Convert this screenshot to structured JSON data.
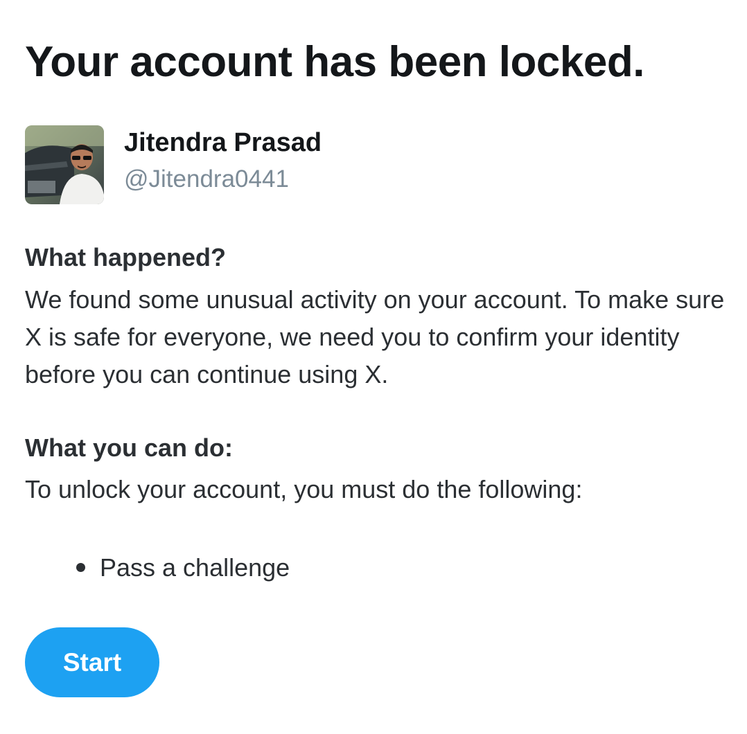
{
  "page": {
    "title": "Your account has been locked."
  },
  "profile": {
    "display_name": "Jitendra Prasad",
    "handle": "@Jitendra0441",
    "avatar_icon": "user-photo"
  },
  "what_happened": {
    "heading": "What happened?",
    "body": "We found some unusual activity on your account. To make sure X is safe for everyone, we need you to confirm your identity before you can continue using X."
  },
  "what_you_can_do": {
    "heading": "What you can do:",
    "body": "To unlock your account, you must do the following:",
    "steps": [
      "Pass a challenge"
    ]
  },
  "actions": {
    "start_label": "Start"
  },
  "colors": {
    "accent": "#1da1f2",
    "text": "#14171a",
    "secondary_text": "#7c8b97"
  }
}
